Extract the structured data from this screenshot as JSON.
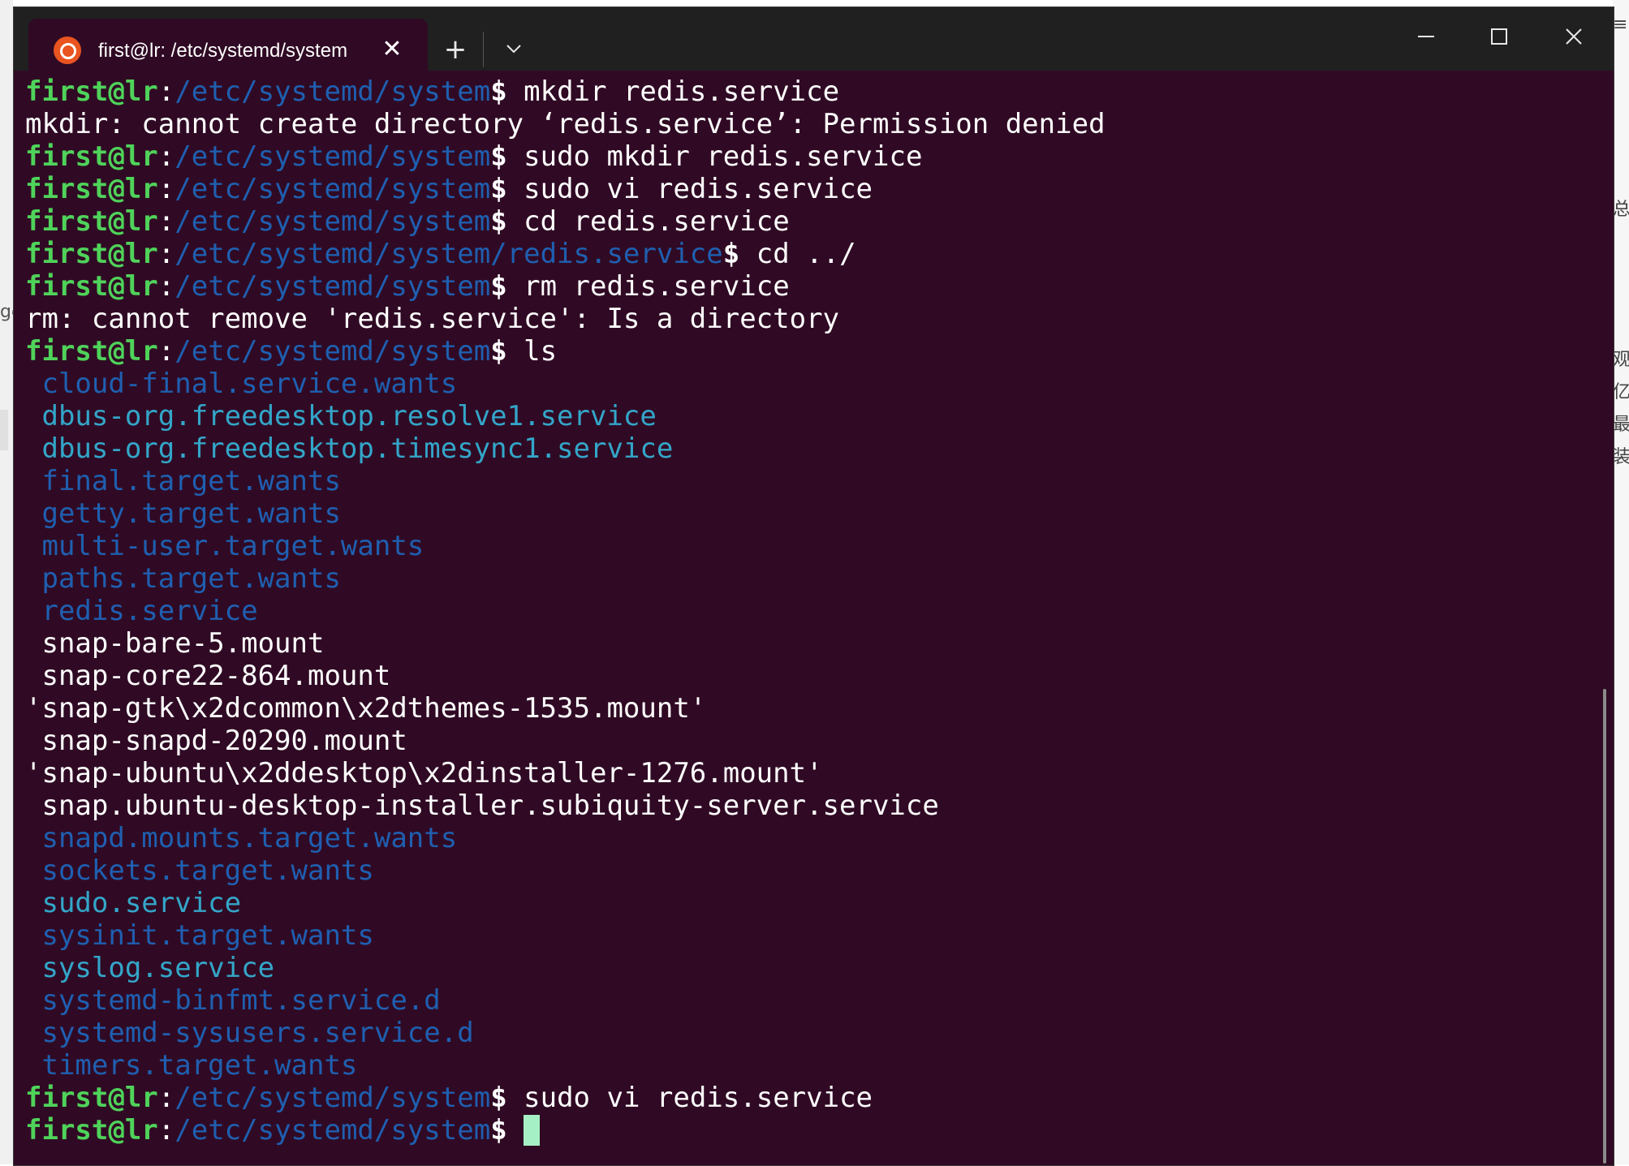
{
  "window": {
    "tab_title": "first@lr: /etc/systemd/system",
    "tab_icon": "ubuntu-logo-icon",
    "new_tab_label": "+",
    "close_tab_label": "✕",
    "colors": {
      "background": "#300a24",
      "titlebar": "#202020",
      "user": "#4fd35a",
      "path": "#1f5fb0",
      "service": "#33a6c9",
      "cursor": "#a6f0c6"
    }
  },
  "terminal": {
    "prompt": {
      "user": "first@lr",
      "colon": ":",
      "dollar": "$"
    },
    "lines": [
      {
        "path": "/etc/systemd/system",
        "cmd": " mkdir redis.service"
      },
      {
        "out": "mkdir: cannot create directory ‘redis.service’: Permission denied"
      },
      {
        "path": "/etc/systemd/system",
        "cmd": " sudo mkdir redis.service"
      },
      {
        "path": "/etc/systemd/system",
        "cmd": " sudo vi redis.service"
      },
      {
        "path": "/etc/systemd/system",
        "cmd": " cd redis.service"
      },
      {
        "path": "/etc/systemd/system/redis.service",
        "cmd": " cd ../"
      },
      {
        "path": "/etc/systemd/system",
        "cmd": " rm redis.service"
      },
      {
        "out": "rm: cannot remove 'redis.service': Is a directory"
      },
      {
        "path": "/etc/systemd/system",
        "cmd": " ls"
      }
    ],
    "listing": [
      {
        "name": " cloud-final.service.wants",
        "kind": "dir"
      },
      {
        "name": " dbus-org.freedesktop.resolve1.service",
        "kind": "svc"
      },
      {
        "name": " dbus-org.freedesktop.timesync1.service",
        "kind": "svc"
      },
      {
        "name": " final.target.wants",
        "kind": "dir"
      },
      {
        "name": " getty.target.wants",
        "kind": "dir"
      },
      {
        "name": " multi-user.target.wants",
        "kind": "dir"
      },
      {
        "name": " paths.target.wants",
        "kind": "dir"
      },
      {
        "name": " redis.service",
        "kind": "dir"
      },
      {
        "name": " snap-bare-5.mount",
        "kind": "file"
      },
      {
        "name": " snap-core22-864.mount",
        "kind": "file"
      },
      {
        "name": "'snap-gtk\\x2dcommon\\x2dthemes-1535.mount'",
        "kind": "file"
      },
      {
        "name": " snap-snapd-20290.mount",
        "kind": "file"
      },
      {
        "name": "'snap-ubuntu\\x2ddesktop\\x2dinstaller-1276.mount'",
        "kind": "file"
      },
      {
        "name": " snap.ubuntu-desktop-installer.subiquity-server.service",
        "kind": "file"
      },
      {
        "name": " snapd.mounts.target.wants",
        "kind": "dir"
      },
      {
        "name": " sockets.target.wants",
        "kind": "dir"
      },
      {
        "name": " sudo.service",
        "kind": "svc"
      },
      {
        "name": " sysinit.target.wants",
        "kind": "dir"
      },
      {
        "name": " syslog.service",
        "kind": "svc"
      },
      {
        "name": " systemd-binfmt.service.d",
        "kind": "dir"
      },
      {
        "name": " systemd-sysusers.service.d",
        "kind": "dir"
      },
      {
        "name": " timers.target.wants",
        "kind": "dir"
      }
    ],
    "tail": [
      {
        "path": "/etc/systemd/system",
        "cmd": " sudo vi redis.service"
      },
      {
        "path": "/etc/systemd/system",
        "cmd": " ",
        "cursor": true
      }
    ]
  },
  "background": {
    "left_mark": "ge",
    "right_chars": [
      "≡",
      "总",
      "观",
      "亿",
      "最",
      "装"
    ]
  }
}
